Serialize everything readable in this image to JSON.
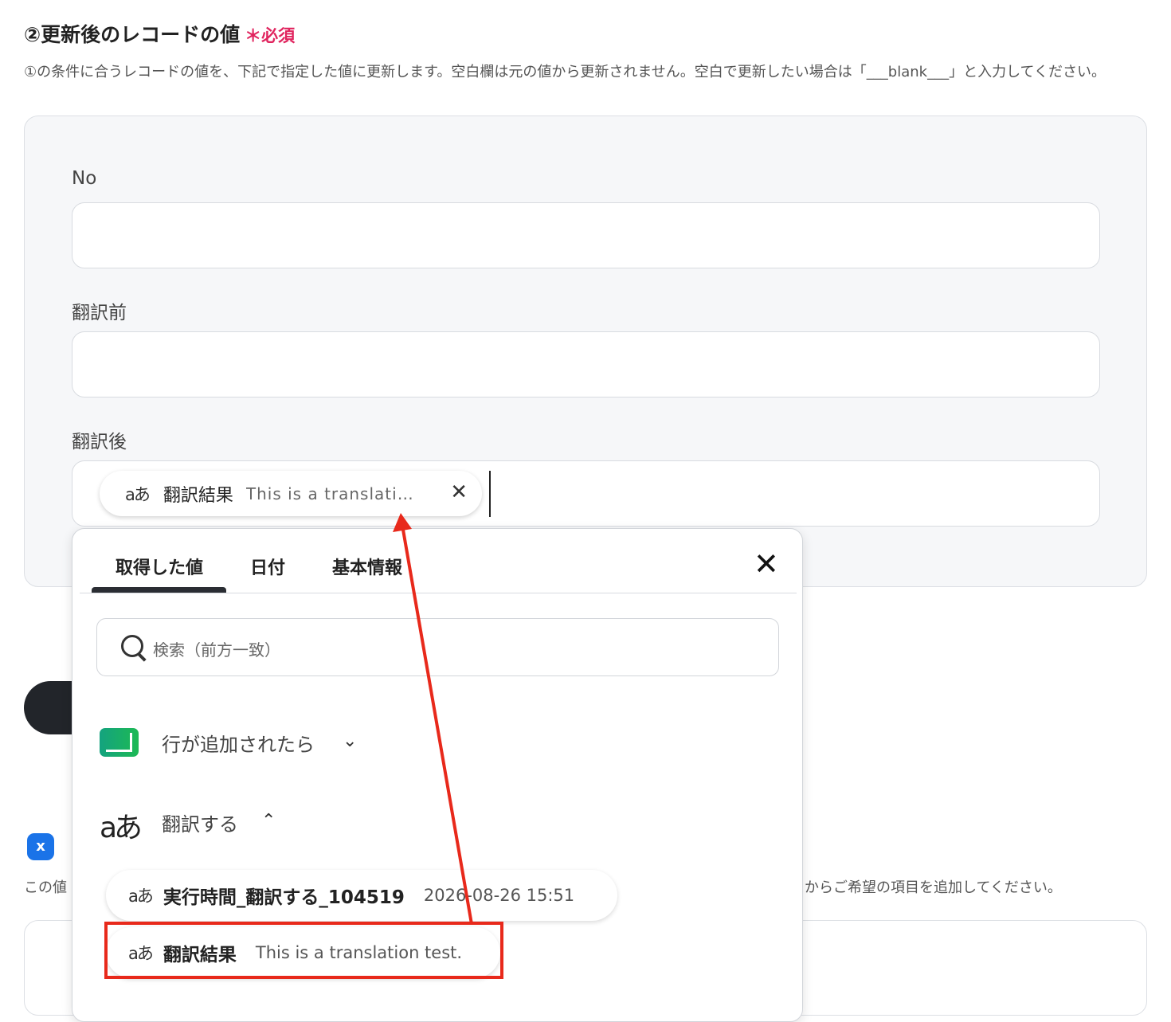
{
  "section": {
    "title": "②更新後のレコードの値",
    "required_mark": "＊必須",
    "description": "①の条件に合うレコードの値を、下記で指定した値に更新します。空白欄は元の値から更新されません。空白で更新したい場合は「___blank___」と入力してください。"
  },
  "fields": [
    {
      "label": "No",
      "value": ""
    },
    {
      "label": "翻訳前",
      "value": ""
    },
    {
      "label": "翻訳後",
      "value": ""
    }
  ],
  "field_chip": {
    "icon": "aあ",
    "name": "翻訳結果",
    "value": "This is a translati..."
  },
  "background": {
    "text_left": "この値",
    "text_right": "からご希望の項目を追加してください。",
    "shield_glyph": "x"
  },
  "popup": {
    "tabs": [
      "取得した値",
      "日付",
      "基本情報"
    ],
    "active_tab": "取得した値",
    "search_placeholder": "検索（前方一致）",
    "groups": [
      {
        "title": "行が追加されたら",
        "expanded": false
      },
      {
        "title": "翻訳する",
        "expanded": true
      }
    ],
    "items": [
      {
        "icon": "aあ",
        "name": "実行時間_翻訳する_104519",
        "value": "2026-08-26 15:51"
      },
      {
        "icon": "aあ",
        "name": "翻訳結果",
        "value": "This is a translation test."
      }
    ],
    "big_icon": "aあ"
  },
  "colors": {
    "required": "#e0245e",
    "annotation": "#e8291b",
    "sheet_icon": "#1db954",
    "shield": "#1a73e8"
  }
}
